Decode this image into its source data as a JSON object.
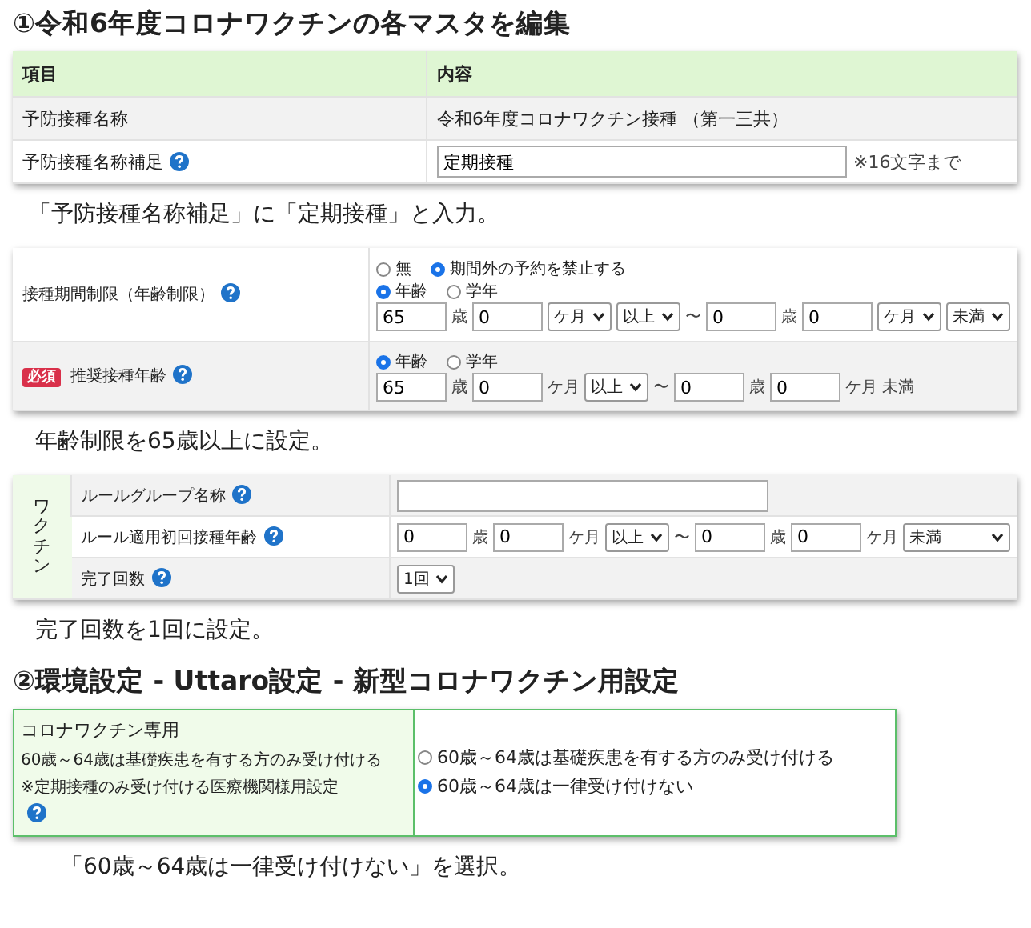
{
  "heading_1": "①令和6年度コロナワクチンの各マスタを編集",
  "master_table": {
    "header": {
      "label": "項目",
      "value": "内容"
    },
    "rows": [
      {
        "label": "予防接種名称",
        "help": false,
        "controls": [
          {
            "kind": "text",
            "text": "令和6年度コロナワクチン接種 （第一三共）"
          }
        ]
      },
      {
        "label": "予防接種名称補足",
        "help": true,
        "controls": [
          {
            "kind": "input",
            "value": "定期接種",
            "note": "※16文字まで"
          }
        ]
      }
    ]
  },
  "caption_1": "「予防接種名称補足」に「定期接種」と入力。",
  "age_table": {
    "rows": [
      {
        "label": "接種期間制限（年齢制限）",
        "help": true,
        "controls": [
          {
            "kind": "radios",
            "options": [
              {
                "label": "無",
                "selected": false
              },
              {
                "label": "期間外の予約を禁止する",
                "selected": true
              }
            ]
          },
          {
            "kind": "radios",
            "options": [
              {
                "label": "年齢",
                "selected": true
              },
              {
                "label": "学年",
                "selected": false
              }
            ]
          },
          {
            "kind": "parts",
            "parts": [
              {
                "kind": "input",
                "value": "65"
              },
              {
                "kind": "text",
                "text": "歳"
              },
              {
                "kind": "input",
                "value": "0"
              },
              {
                "kind": "select",
                "value": "ケ月"
              },
              {
                "kind": "select",
                "value": "以上"
              },
              {
                "kind": "text",
                "text": "〜"
              },
              {
                "kind": "input",
                "value": "0"
              },
              {
                "kind": "text",
                "text": "歳"
              },
              {
                "kind": "input",
                "value": "0"
              },
              {
                "kind": "select",
                "value": "ケ月"
              },
              {
                "kind": "select",
                "value": "未満"
              }
            ]
          }
        ]
      },
      {
        "label": "推奨接種年齢",
        "badge": "必須",
        "help": true,
        "controls": [
          {
            "kind": "radios",
            "options": [
              {
                "label": "年齢",
                "selected": true
              },
              {
                "label": "学年",
                "selected": false
              }
            ]
          },
          {
            "kind": "parts",
            "parts": [
              {
                "kind": "input",
                "value": "65"
              },
              {
                "kind": "text",
                "text": "歳"
              },
              {
                "kind": "input",
                "value": "0"
              },
              {
                "kind": "text",
                "text": "ケ月"
              },
              {
                "kind": "select",
                "value": "以上"
              },
              {
                "kind": "text",
                "text": "〜"
              },
              {
                "kind": "input",
                "value": "0"
              },
              {
                "kind": "text",
                "text": "歳"
              },
              {
                "kind": "input",
                "value": "0"
              },
              {
                "kind": "text",
                "text": "ケ月 未満"
              }
            ]
          }
        ]
      }
    ]
  },
  "caption_2": "年齢制限を65歳以上に設定。",
  "rule_table": {
    "group_label": "ワクチン",
    "rows": [
      {
        "label": "ルールグループ名称",
        "help": true,
        "controls": [
          {
            "kind": "input"
          }
        ]
      },
      {
        "label": "ルール適用初回接種年齢",
        "help": true,
        "controls": [
          {
            "kind": "parts",
            "parts": [
              {
                "kind": "input",
                "value": "0"
              },
              {
                "kind": "text",
                "text": "歳"
              },
              {
                "kind": "input",
                "value": "0"
              },
              {
                "kind": "text",
                "text": "ケ月"
              },
              {
                "kind": "select",
                "value": "以上"
              },
              {
                "kind": "text",
                "text": "〜"
              },
              {
                "kind": "input",
                "value": "0"
              },
              {
                "kind": "text",
                "text": "歳"
              },
              {
                "kind": "input",
                "value": "0"
              },
              {
                "kind": "text",
                "text": "ケ月"
              },
              {
                "kind": "select",
                "value": "未満"
              }
            ]
          }
        ]
      },
      {
        "label": "完了回数",
        "help": true,
        "controls": [
          {
            "kind": "select",
            "value": "1回"
          }
        ]
      }
    ]
  },
  "caption_3": "完了回数を1回に設定。",
  "heading_2": "②環境設定 - Uttaro設定 - 新型コロナワクチン用設定",
  "settings_table": {
    "lines": [
      "コロナワクチン専用",
      "60歳～64歳は基礎疾患を有する方のみ受け付ける",
      "※定期接種のみ受け付ける医療機関様用設定"
    ],
    "help": true,
    "options": [
      {
        "label": "60歳～64歳は基礎疾患を有する方のみ受け付ける",
        "selected": false
      },
      {
        "label": "60歳～64歳は一律受け付けない",
        "selected": true
      }
    ]
  },
  "caption_4": "「60歳～64歳は一律受け付けない」を選択。"
}
